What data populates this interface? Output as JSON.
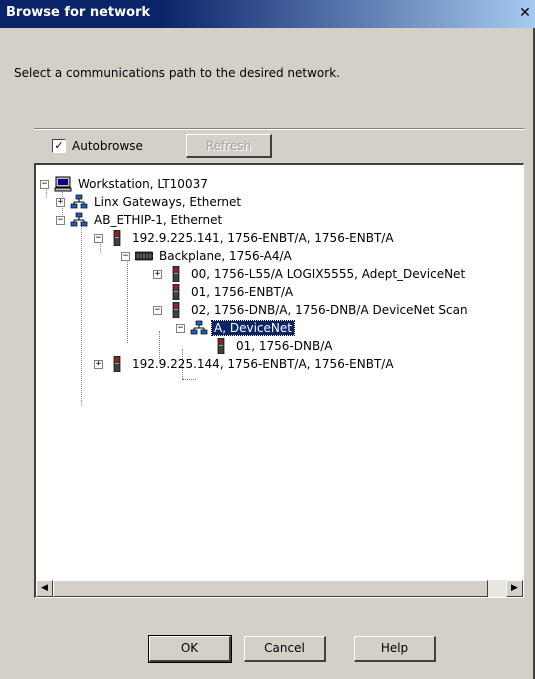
{
  "window": {
    "title": "Browse for network",
    "close_glyph": "✕"
  },
  "instruction": "Select a communications path to the desired network.",
  "autobrowse": {
    "label": "Autobrowse",
    "checked": true,
    "check_glyph": "✓"
  },
  "refresh_label": "Refresh",
  "tree": {
    "nodes": [
      {
        "label": "Workstation, LT10037",
        "icon": "computer-icon",
        "expander": "−"
      },
      {
        "label": "Linx Gateways, Ethernet",
        "icon": "network-icon",
        "expander": "+"
      },
      {
        "label": "AB_ETHIP-1, Ethernet",
        "icon": "network-icon",
        "expander": "−"
      },
      {
        "label": "192.9.225.141, 1756-ENBT/A, 1756-ENBT/A",
        "icon": "module-icon",
        "expander": "−"
      },
      {
        "label": "Backplane, 1756-A4/A",
        "icon": "backplane-icon",
        "expander": "−"
      },
      {
        "label": "00, 1756-L55/A LOGIX5555, Adept_DeviceNet",
        "icon": "module-icon",
        "expander": "+"
      },
      {
        "label": "01, 1756-ENBT/A",
        "icon": "module-icon",
        "expander": ""
      },
      {
        "label": "02, 1756-DNB/A, 1756-DNB/A DeviceNet Scan",
        "icon": "module-icon",
        "expander": "−"
      },
      {
        "label": "A, DeviceNet",
        "icon": "network-icon",
        "expander": "−",
        "selected": true
      },
      {
        "label": "01, 1756-DNB/A",
        "icon": "module-icon",
        "expander": ""
      },
      {
        "label": "192.9.225.144, 1756-ENBT/A, 1756-ENBT/A",
        "icon": "module-icon",
        "expander": "+"
      }
    ]
  },
  "scrollbar": {
    "left_glyph": "◀",
    "right_glyph": "▶"
  },
  "buttons": {
    "ok": "OK",
    "cancel": "Cancel",
    "help": "Help"
  },
  "colors": {
    "title_bar": "#0a246a",
    "dialog_bg": "#d4d0c8",
    "selection": "#0a246a"
  }
}
